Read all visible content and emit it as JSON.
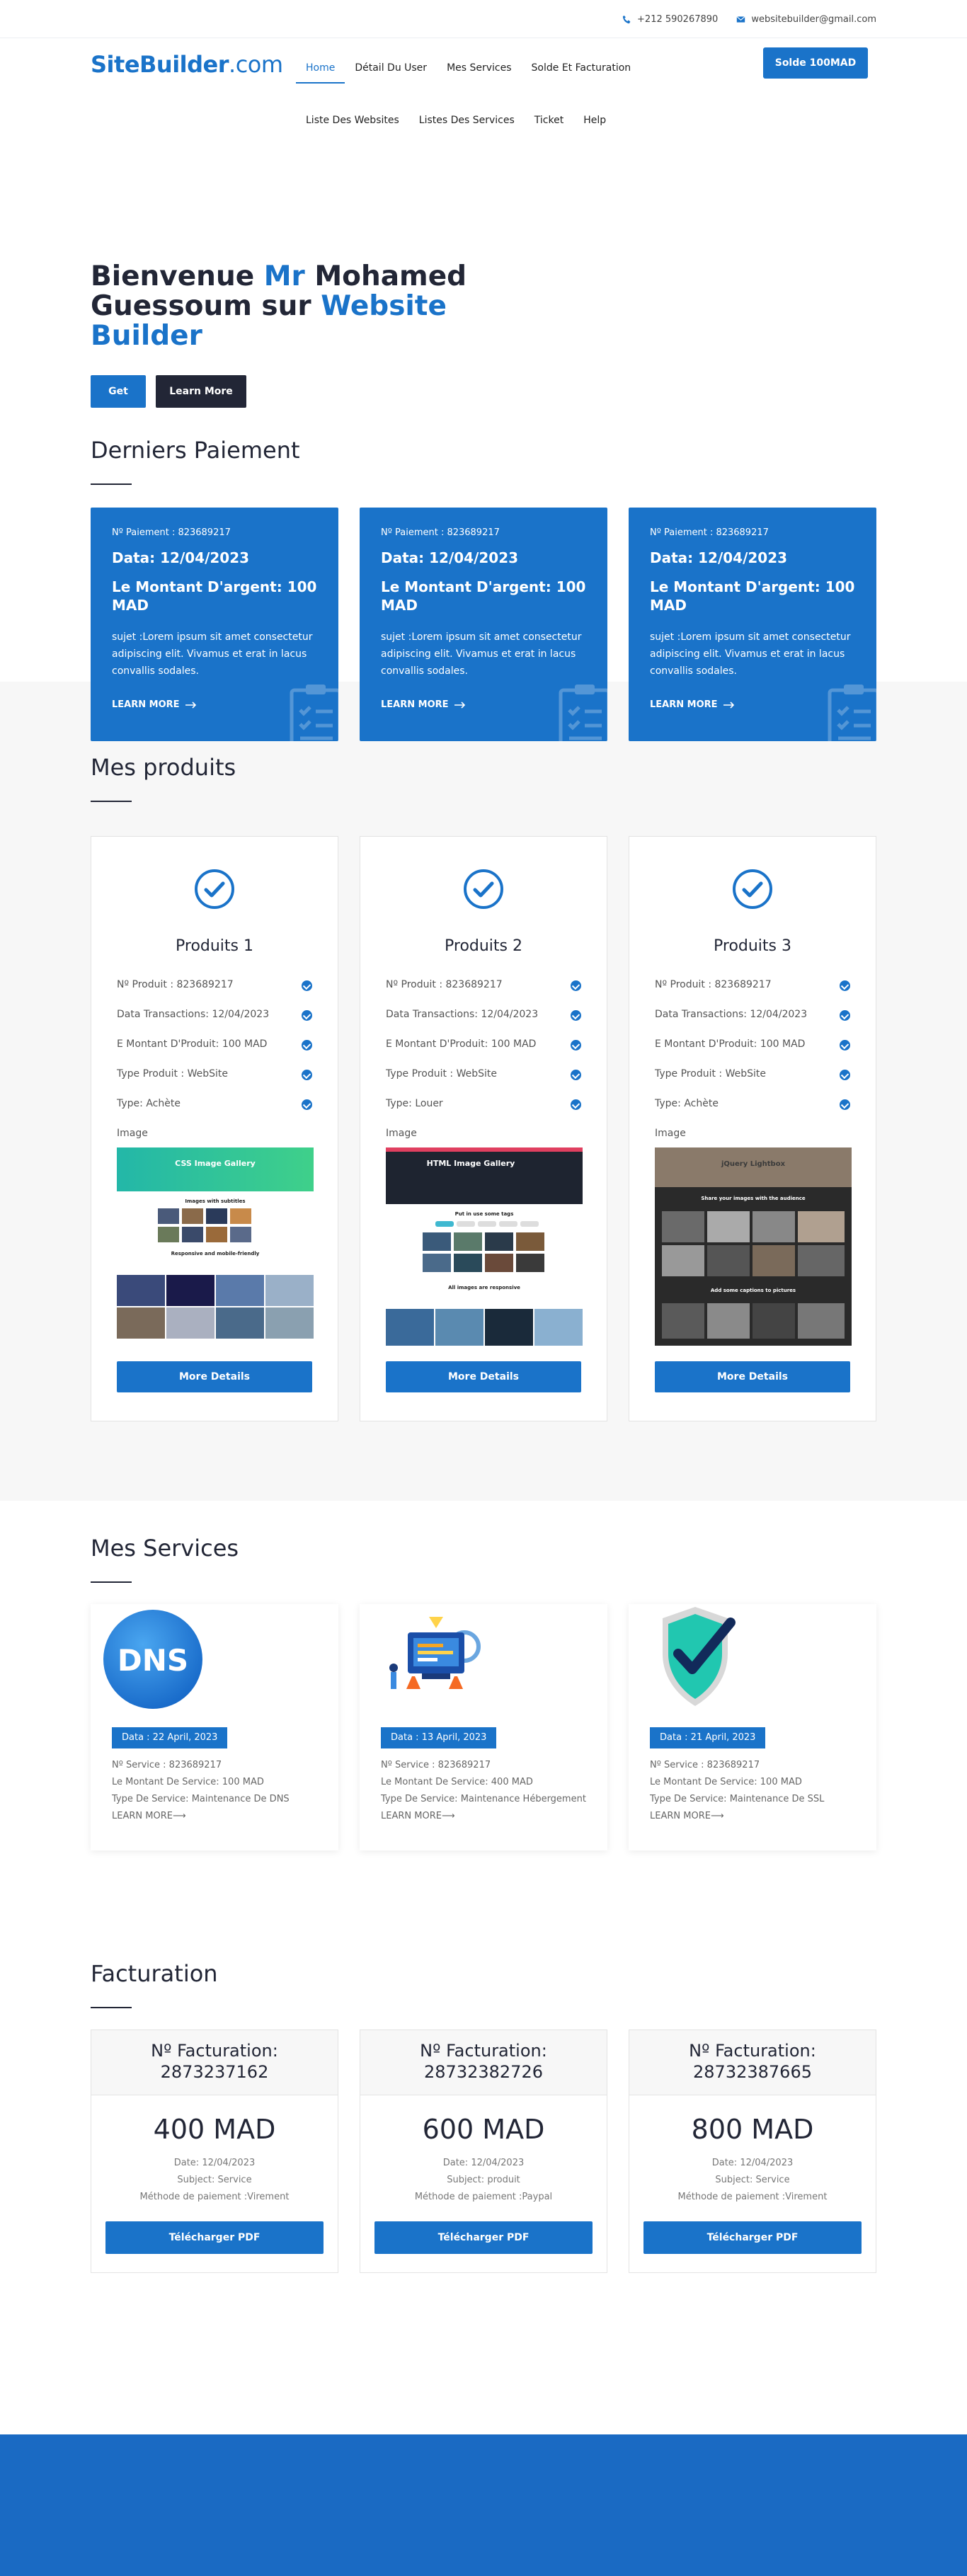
{
  "topbar": {
    "phone": "+212 590267890",
    "email": "websitebuilder@gmail.com"
  },
  "header": {
    "logo_main": "SiteBuilder",
    "logo_suffix": ".com",
    "nav": [
      "Home",
      "Détail Du User",
      "Mes Services",
      "Solde Et Facturation",
      "Liste Des Websites",
      "Listes Des Services",
      "Ticket",
      "Help"
    ],
    "solde_button": "Solde 100MAD"
  },
  "hero": {
    "title_part1": "Bienvenue ",
    "title_mr": "Mr",
    "title_part2": " Mohamed Guessoum sur ",
    "title_brand": "Website Builder",
    "get_button": "Get",
    "learn_button": "Learn More"
  },
  "paiement": {
    "title": "Derniers Paiement",
    "cards": [
      {
        "no": "Nº Paiement : 823689217",
        "date": "Data: 12/04/2023",
        "montant": "Le Montant D'argent: 100 MAD",
        "sujet": "sujet :Lorem ipsum sit amet consectetur adipiscing elit. Vivamus et erat in lacus convallis sodales.",
        "link": "LEARN MORE"
      },
      {
        "no": "Nº Paiement : 823689217",
        "date": "Data: 12/04/2023",
        "montant": "Le Montant D'argent: 100 MAD",
        "sujet": "sujet :Lorem ipsum sit amet consectetur adipiscing elit. Vivamus et erat in lacus convallis sodales.",
        "link": "LEARN MORE"
      },
      {
        "no": "Nº Paiement : 823689217",
        "date": "Data: 12/04/2023",
        "montant": "Le Montant D'argent: 100 MAD",
        "sujet": "sujet :Lorem ipsum sit amet consectetur adipiscing elit. Vivamus et erat in lacus convallis sodales.",
        "link": "LEARN MORE"
      }
    ]
  },
  "produits": {
    "title": "Mes produits",
    "cards": [
      {
        "name": "Produits 1",
        "lines": [
          "Nº Produit : 823689217",
          "Data Transactions: 12/04/2023",
          "E Montant D'Produit: 100 MAD",
          "Type Produit : WebSite",
          "Type: Achète"
        ],
        "image_label": "Image",
        "shot_title": "CSS Image Gallery",
        "shot_sub1": "Images with subtitles",
        "shot_sub2": "Responsive and mobile-friendly",
        "button": "More Details"
      },
      {
        "name": "Produits 2",
        "lines": [
          "Nº Produit : 823689217",
          "Data Transactions: 12/04/2023",
          "E Montant D'Produit: 100 MAD",
          "Type Produit : WebSite",
          "Type: Louer"
        ],
        "image_label": "Image",
        "shot_title": "HTML Image Gallery",
        "shot_sub1": "Put in use some tags",
        "shot_sub2": "All images are responsive",
        "button": "More Details"
      },
      {
        "name": "Produits 3",
        "lines": [
          "Nº Produit : 823689217",
          "Data Transactions: 12/04/2023",
          "E Montant D'Produit: 100 MAD",
          "Type Produit : WebSite",
          "Type: Achète"
        ],
        "image_label": "Image",
        "shot_title": "jQuery Lightbox",
        "shot_sub1": "Share your images with the audience",
        "shot_sub2": "Add some captions to pictures",
        "button": "More Details"
      }
    ]
  },
  "services": {
    "title": "Mes Services",
    "cards": [
      {
        "icon_text": "DNS",
        "date": "Data : 22 April, 2023",
        "no": "Nº Service : 823689217",
        "montant": "Le Montant De Service: 100 MAD",
        "type": "Type De Service: Maintenance De DNS",
        "link": "LEARN MORE"
      },
      {
        "icon_text": "",
        "date": "Data : 13 April, 2023",
        "no": "Nº Service : 823689217",
        "montant": "Le Montant De Service: 400 MAD",
        "type": "Type De Service: Maintenance Hébergement",
        "link": "LEARN MORE"
      },
      {
        "icon_text": "",
        "date": "Data : 21 April, 2023",
        "no": "Nº Service : 823689217",
        "montant": "Le Montant De Service: 100 MAD",
        "type": "Type De Service: Maintenance De SSL",
        "link": "LEARN MORE"
      }
    ]
  },
  "facturation": {
    "title": "Facturation",
    "cards": [
      {
        "head1": "Nº Facturation:",
        "head2": "2873237162",
        "amount": "400 MAD",
        "date": "Date: 12/04/2023",
        "subject": "Subject: Service",
        "method": "Méthode de paiement :Virement",
        "button": "Télécharger PDF"
      },
      {
        "head1": "Nº Facturation:",
        "head2": "28732382726",
        "amount": "600 MAD",
        "date": "Date: 12/04/2023",
        "subject": "Subject: produit",
        "method": "Méthode de paiement :Paypal",
        "button": "Télécharger PDF"
      },
      {
        "head1": "Nº Facturation:",
        "head2": "28732387665",
        "amount": "800 MAD",
        "date": "Date: 12/04/2023",
        "subject": "Subject: Service",
        "method": "Méthode de paiement :Virement",
        "button": "Télécharger PDF"
      }
    ]
  },
  "colors": {
    "brand": "#1a73c9",
    "dark": "#222636",
    "light_bg": "#f7f7f7",
    "footer": "#1a6ac3"
  }
}
